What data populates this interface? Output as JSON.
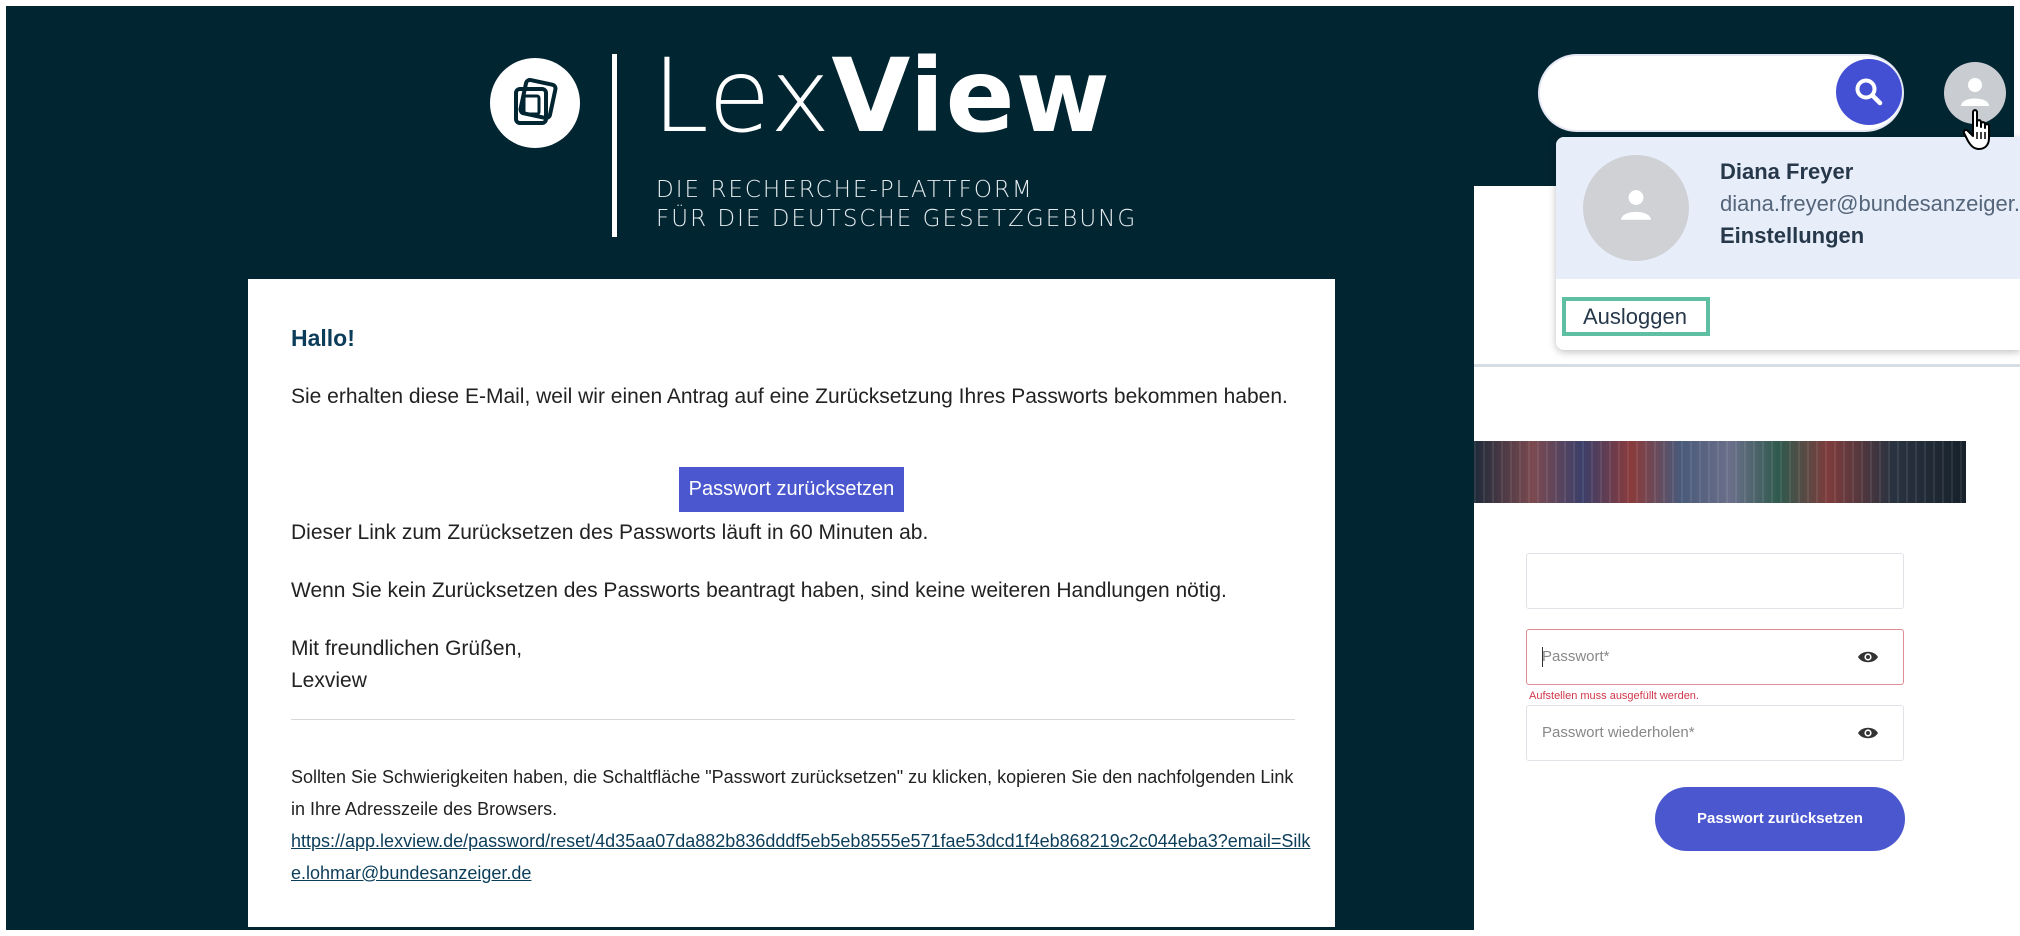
{
  "logo": {
    "word_lex": "Lex",
    "word_view": "View",
    "tagline_line1": "DIE RECHERCHE-PLATTFORM",
    "tagline_line2": "FÜR DIE DEUTSCHE GESETZGEBUNG",
    "icon": "lexview-logo-icon"
  },
  "email": {
    "greeting": "Hallo!",
    "paragraph1": "Sie erhalten diese E-Mail, weil wir einen Antrag auf eine Zurücksetzung Ihres Passworts bekommen haben.",
    "reset_button": "Passwort zurücksetzen",
    "paragraph2": "Dieser Link zum Zurücksetzen des Passworts läuft in 60 Minuten ab.",
    "paragraph3": "Wenn Sie kein Zurücksetzen des Passworts beantragt haben, sind keine weiteren Handlungen nötig.",
    "closing": "Mit freundlichen Grüßen,",
    "signature": "Lexview",
    "help_text": "Sollten Sie Schwierigkeiten haben, die Schaltfläche \"Passwort zurücksetzen\" zu klicken, kopieren Sie den nachfolgenden Link in Ihre Adresszeile des Browsers.",
    "reset_link": "https://app.lexview.de/password/reset/4d35aa07da882b836dddf5eb5eb8555e571fae53dcd1f4eb868219c2c044eba3?email=Silke.lohmar@bundesanzeiger.de"
  },
  "header": {
    "search_placeholder": "",
    "search_icon": "search-icon",
    "avatar_icon": "user-icon"
  },
  "user_menu": {
    "name": "Diana Freyer",
    "email": "diana.freyer@bundesanzeiger.de",
    "settings": "Einstellungen",
    "logout": "Ausloggen"
  },
  "reset_form": {
    "field1_value": "",
    "password_placeholder": "Passwort*",
    "error_text": "Aufstellen muss ausgefüllt werden.",
    "repeat_placeholder": "Passwort wiederholen*",
    "submit": "Passwort zurücksetzen",
    "eye_icon": "eye-icon"
  },
  "colors": {
    "background": "#022532",
    "accent": "#4b57cf",
    "highlight": "#5fbfa3",
    "error": "#d0364a"
  }
}
